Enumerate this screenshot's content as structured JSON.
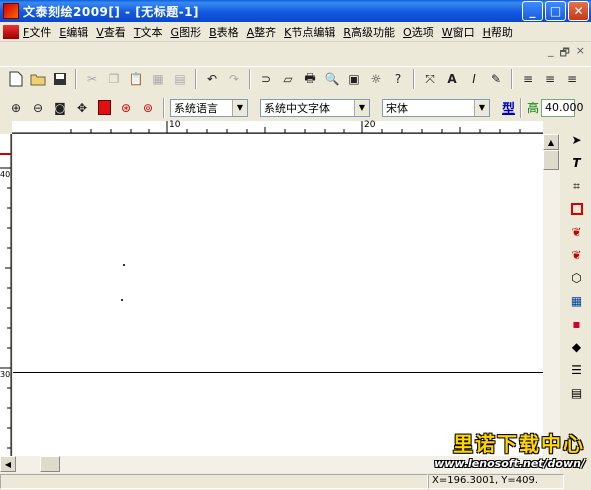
{
  "window": {
    "title": "文泰刻绘2009[] - [无标题-1]",
    "minimize": "_",
    "maximize": "□",
    "close": "✕"
  },
  "menu": {
    "items": [
      {
        "key": "F",
        "label": "文件"
      },
      {
        "key": "E",
        "label": "编辑"
      },
      {
        "key": "V",
        "label": "查看"
      },
      {
        "key": "T",
        "label": "文本"
      },
      {
        "key": "G",
        "label": "图形"
      },
      {
        "key": "B",
        "label": "表格"
      },
      {
        "key": "A",
        "label": "整齐"
      },
      {
        "key": "K",
        "label": "节点编辑"
      },
      {
        "key": "R",
        "label": "高级功能"
      },
      {
        "key": "O",
        "label": "选项"
      },
      {
        "key": "W",
        "label": "窗口"
      },
      {
        "key": "H",
        "label": "帮助"
      }
    ],
    "mdi_minimize": "_",
    "mdi_restore": "🗗",
    "mdi_close": "×"
  },
  "toolbar1": {
    "icons": [
      "new-icon",
      "open-icon",
      "save-icon",
      "cut-icon",
      "copy-icon",
      "paste-icon",
      "group-icon",
      "ungroup-icon",
      "undo-icon",
      "redo-icon",
      "curve-icon",
      "page-icon",
      "print-icon",
      "preview-icon",
      "output-icon",
      "light-icon",
      "help-icon",
      "align-icon",
      "text-a-icon",
      "italic-icon",
      "edit-icon",
      "align-left-icon",
      "align-center-icon",
      "align-right-icon"
    ]
  },
  "toolbar2": {
    "language_combo": "系统语言",
    "font_set_combo": "系统中文字体",
    "font_combo": "宋体",
    "type_label": "型",
    "height_label": "高",
    "height_value": "40.000"
  },
  "ruler": {
    "h_labels": [
      "10",
      "20"
    ],
    "v_labels": [
      "40",
      "30"
    ]
  },
  "status": {
    "coords": "X=196.3001, Y=409."
  },
  "watermark": {
    "title": "里诺下载中心",
    "url": "www.lenosoft.net/down/"
  },
  "colors": {
    "titlebar": "#0b5ae0",
    "fill_swatch": "#e01010",
    "watermark_yellow": "#ffd400"
  }
}
